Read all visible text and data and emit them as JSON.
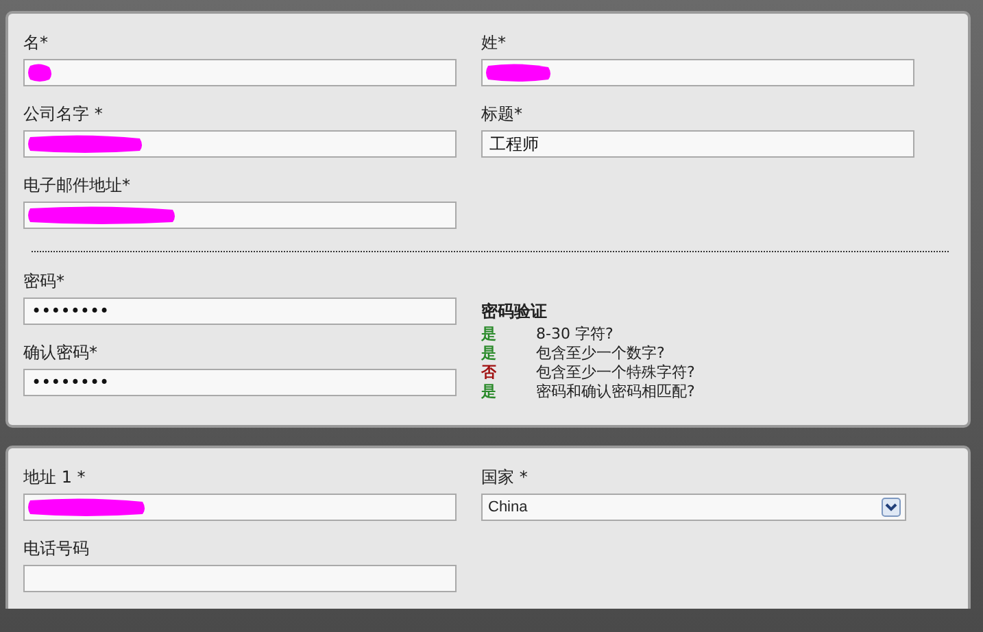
{
  "sections": [
    {
      "fields": [
        {
          "label": "名*",
          "redacted": true,
          "kind": "text"
        },
        {
          "label": "姓*",
          "redacted": true,
          "kind": "text"
        },
        {
          "label": "公司名字 *",
          "redacted": true,
          "kind": "text"
        },
        {
          "label": "标题*",
          "value": "工程师",
          "kind": "text"
        },
        {
          "label": "电子邮件地址*",
          "redacted": true,
          "kind": "text"
        }
      ]
    },
    {
      "divider": true,
      "fields": [
        {
          "label": "密码*",
          "value": "••••••••",
          "kind": "text"
        },
        {
          "label": "确认密码*",
          "value": "••••••••",
          "kind": "text"
        }
      ],
      "validation": {
        "title": "密码验证",
        "checks": [
          {
            "result": "是",
            "passed": true,
            "text": "8-30 字符?"
          },
          {
            "result": "是",
            "passed": true,
            "text": "包含至少一个数字?"
          },
          {
            "result": "否",
            "passed": false,
            "text": "包含至少一个特殊字符?"
          },
          {
            "result": "是",
            "passed": true,
            "text": "密码和确认密码相匹配?"
          }
        ]
      }
    },
    {
      "fields": [
        {
          "label": "地址 1 *",
          "redacted": true,
          "kind": "text"
        },
        {
          "label": "国家 *",
          "value": "China",
          "kind": "select"
        },
        {
          "label": "电话号码",
          "kind": "text"
        }
      ]
    }
  ]
}
